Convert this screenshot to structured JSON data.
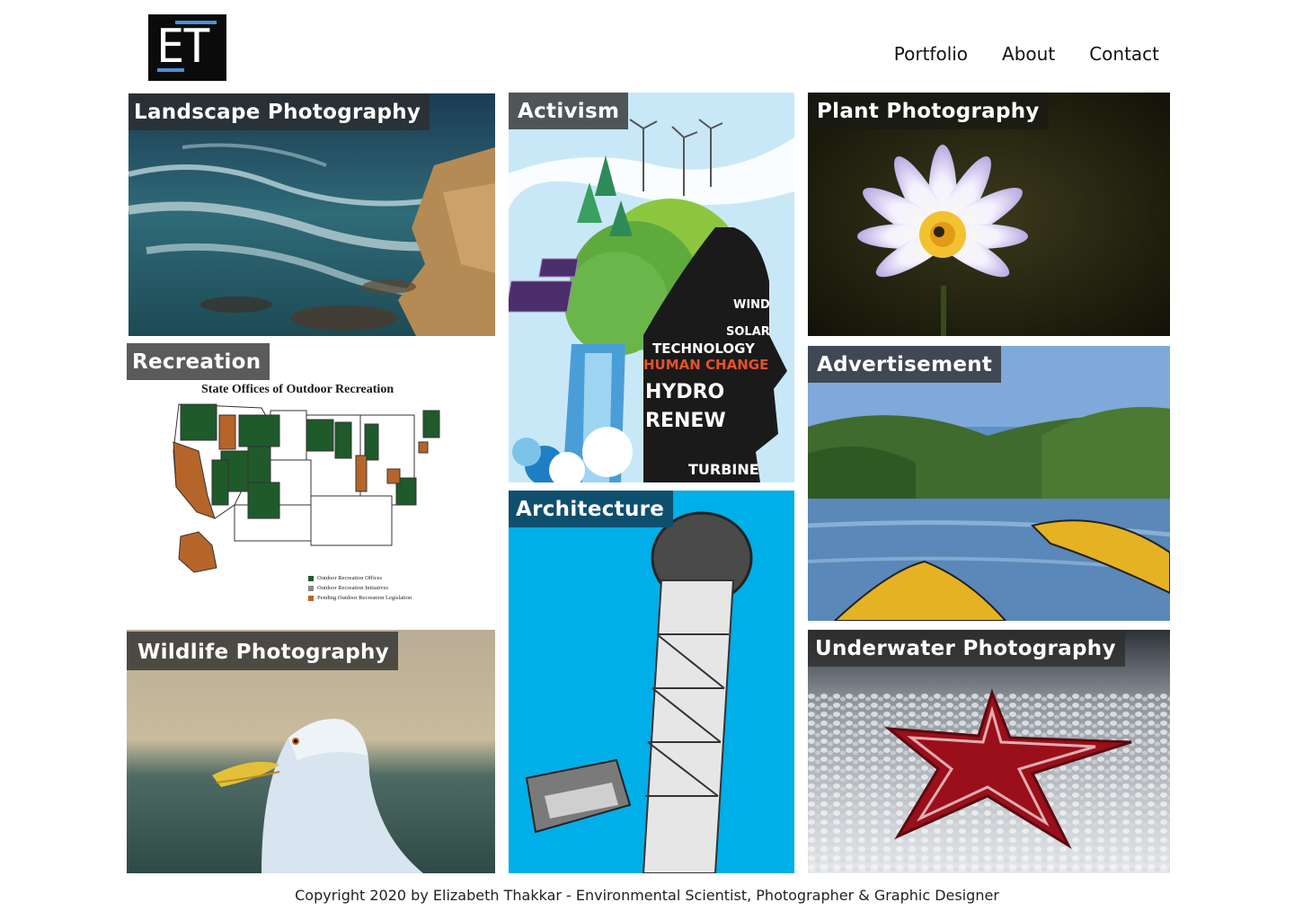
{
  "logo": {
    "text": "ET"
  },
  "nav": {
    "items": [
      "Portfolio",
      "About",
      "Contact"
    ]
  },
  "tiles": {
    "landscape": "Landscape Photography",
    "activism": "Activism",
    "plant": "Plant Photography",
    "recreation": "Recreation",
    "advertisement": "Advertisement",
    "architecture": "Architecture",
    "wildlife": "Wildlife Photography",
    "underwater": "Underwater Photography"
  },
  "recreation_map": {
    "title": "State Offices of Outdoor Recreation",
    "legend": [
      "Outdoor Recreation Offices",
      "Outdoor Recreation Initiatives",
      "Pending Outdoor Recreation Legislation"
    ],
    "legend_colors": [
      "#1f5a2a",
      "#8a8a8a",
      "#b5652a"
    ]
  },
  "activism_words": [
    "TECHNOLOGY",
    "HUMAN CHANGE",
    "HYDRO",
    "RENEW",
    "SOLAR",
    "WIND",
    "TURBINE"
  ],
  "footer": {
    "text": "Copyright 2020 by Elizabeth Thakkar - Environmental Scientist, Photographer & Graphic Designer"
  }
}
